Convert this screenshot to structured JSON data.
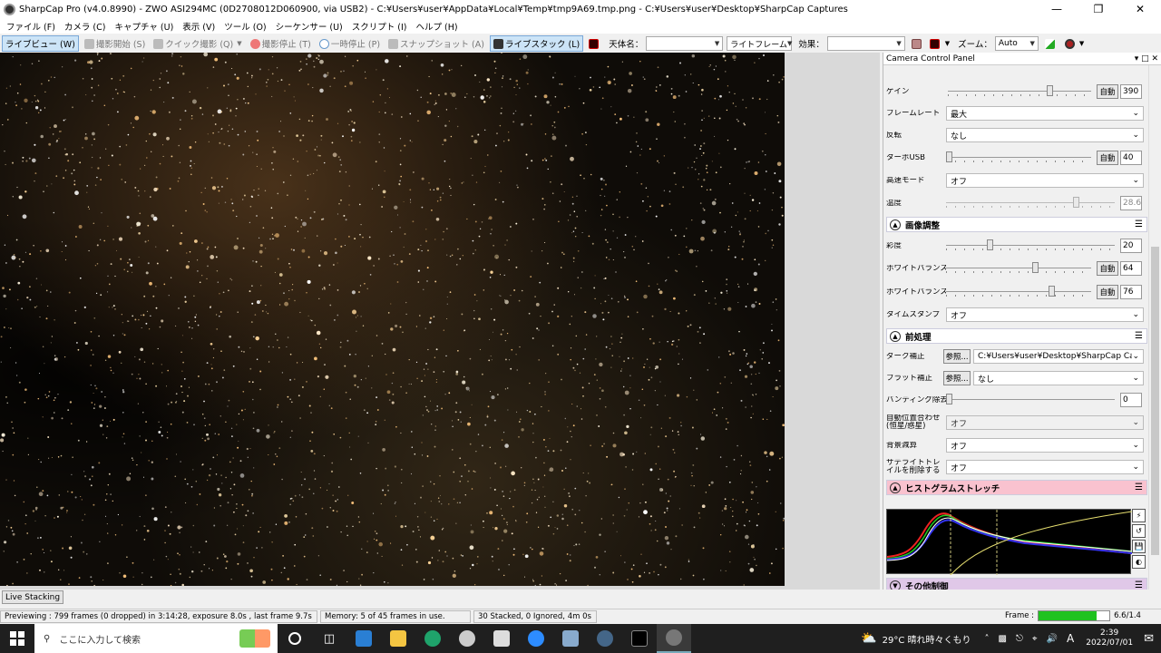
{
  "window": {
    "title": "SharpCap Pro (v4.0.8990) - ZWO ASI294MC (0D2708012D060900, via USB2) - C:¥Users¥user¥AppData¥Local¥Temp¥tmp9A69.tmp.png - C:¥Users¥user¥Desktop¥SharpCap Captures"
  },
  "menu": [
    "ファイル (F)",
    "カメラ (C)",
    "キャプチャ (U)",
    "表示 (V)",
    "ツール (O)",
    "シーケンサー (U)",
    "スクリプト (I)",
    "ヘルプ (H)"
  ],
  "toolbar": {
    "live_view": "ライブビュー (W)",
    "start_capture": "撮影開始 (S)",
    "quick_capture": "クイック撮影 (Q)",
    "stop_capture": "撮影停止 (T)",
    "pause": "一時停止 (P)",
    "snapshot": "スナップショット (A)",
    "live_stack": "ライブスタック (L)",
    "object_label": "天体名：",
    "object_value": "",
    "frame_type": "ライトフレーム",
    "effect_label": "効果：",
    "effect_value": "",
    "zoom_label": "ズーム：",
    "zoom_value": "Auto"
  },
  "panel": {
    "title": "Camera Control Panel",
    "rows": {
      "gain": {
        "label": "ゲイン",
        "auto": "自動",
        "value": "390",
        "level": 0.72
      },
      "framerate": {
        "label": "フレームレート",
        "value": "最大"
      },
      "flip": {
        "label": "反転",
        "value": "なし"
      },
      "turbo": {
        "label": "ターボUSB",
        "auto": "自動",
        "value": "40",
        "level": 0.0
      },
      "highspeed": {
        "label": "高速モード",
        "value": "オフ"
      },
      "temperature": {
        "label": "温度",
        "value": "28.6",
        "level": 0.78
      },
      "saturation": {
        "label": "彩度",
        "value": "20",
        "level": 0.25
      },
      "wb_r": {
        "label": "ホワイトバランス(R)",
        "auto": "自動",
        "value": "64",
        "level": 0.62
      },
      "wb_b": {
        "label": "ホワイトバランス(B)",
        "auto": "自動",
        "value": "76",
        "level": 0.74
      },
      "timestamp": {
        "label": "タイムスタンプ",
        "value": "オフ"
      },
      "dark": {
        "label": "ダーク補正",
        "browse": "参照...",
        "value": "C:¥Users¥user¥Desktop¥SharpCap Ca..."
      },
      "flat": {
        "label": "フラット補正",
        "browse": "参照...",
        "value": "なし"
      },
      "banding": {
        "label": "バンディング除去",
        "value": "0",
        "level": 0.0
      },
      "autoalign": {
        "label": "自動位置合わせ(恒星/惑星)",
        "value": "オフ"
      },
      "bgsub": {
        "label": "背景減算",
        "value": "オフ"
      },
      "satellite": {
        "label": "サテライトトレイルを削除する",
        "value": "オフ"
      }
    },
    "sections": {
      "image": "画像調整",
      "preprocess": "前処理",
      "histogram": "ヒストグラムストレッチ",
      "other": "その他制御"
    }
  },
  "live_stacking_tab": "Live Stacking",
  "status": {
    "previewing": "Previewing : 799 frames (0 dropped) in 3:14:28, exposure 8.0s , last frame 9.7s",
    "memory": "Memory: 5 of 45 frames in use.",
    "stacked": "30 Stacked, 0 Ignored, 4m 0s",
    "frame_label": "Frame :",
    "frame_value": "6.6/1.4",
    "frame_progress": 0.82
  },
  "taskbar": {
    "search_placeholder": "ここに入力して検索",
    "weather": "29°C  晴れ時々くもり",
    "ime": "A",
    "time": "2:39",
    "date": "2022/07/01"
  },
  "colors": {
    "accent": "#cce4f7",
    "histogram_header": "#f9c2cf",
    "other_header": "#e0c8e8",
    "frame_fill": "#1fc21f"
  }
}
